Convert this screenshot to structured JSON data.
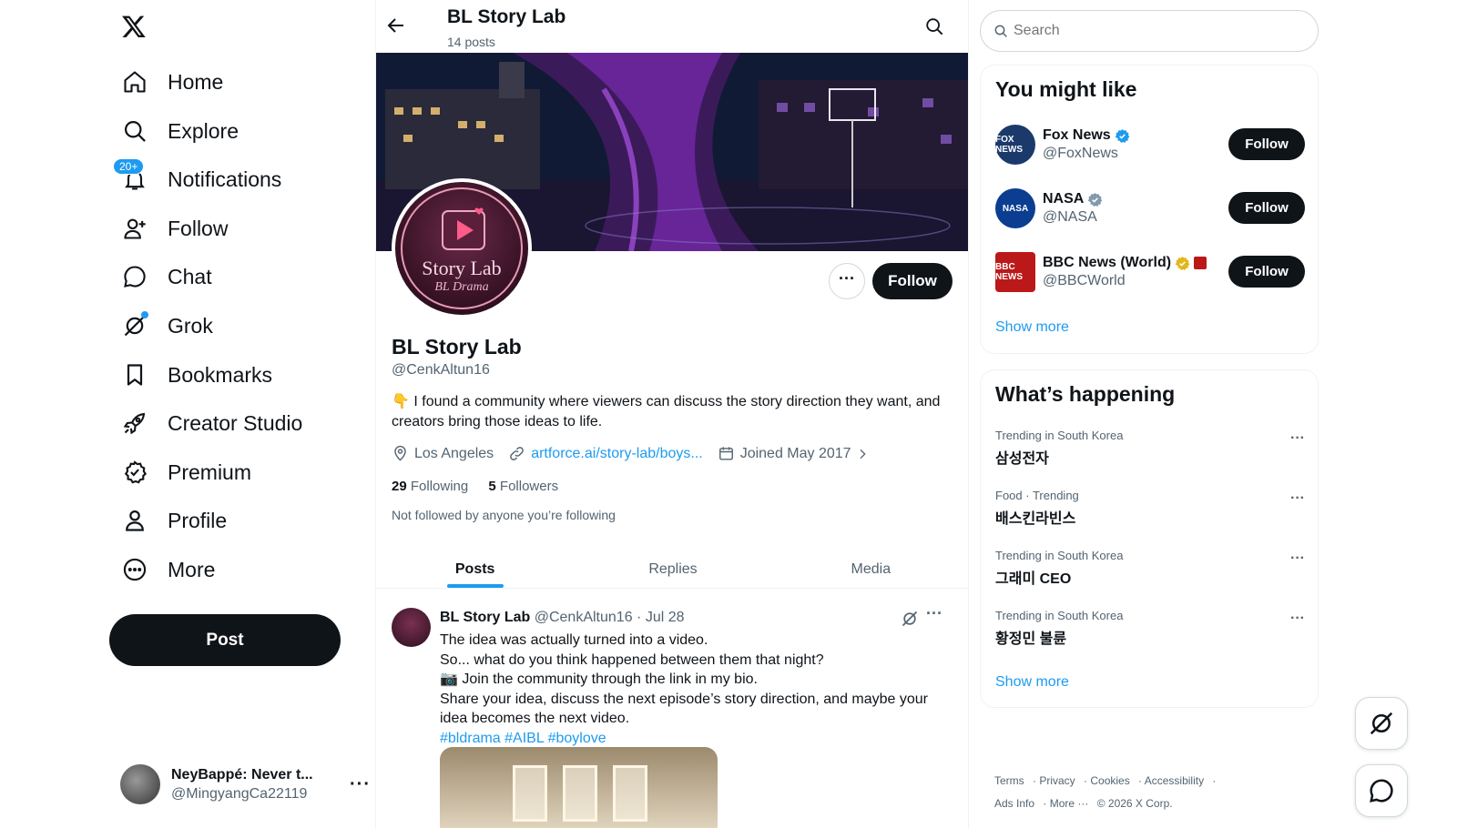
{
  "nav": {
    "items": [
      {
        "label": "Home",
        "icon": "home-icon"
      },
      {
        "label": "Explore",
        "icon": "search-icon"
      },
      {
        "label": "Notifications",
        "icon": "bell-icon",
        "badge": "20+"
      },
      {
        "label": "Follow",
        "icon": "follow-icon"
      },
      {
        "label": "Chat",
        "icon": "chat-icon"
      },
      {
        "label": "Grok",
        "icon": "grok-icon"
      },
      {
        "label": "Bookmarks",
        "icon": "bookmark-icon"
      },
      {
        "label": "Creator Studio",
        "icon": "rocket-icon"
      },
      {
        "label": "Premium",
        "icon": "premium-icon"
      },
      {
        "label": "Profile",
        "icon": "profile-icon"
      },
      {
        "label": "More",
        "icon": "more-circle-icon"
      }
    ],
    "post_label": "Post"
  },
  "account": {
    "name": "NeyBappé: Never t...",
    "handle": "@MingyangCa22119"
  },
  "header": {
    "title": "BL Story Lab",
    "subtitle": "14 posts"
  },
  "profile": {
    "avatar_text": "Story Lab",
    "avatar_subtext": "BL Drama",
    "follow_label": "Follow",
    "name": "BL Story Lab",
    "handle": "@CenkAltun16",
    "bio_emoji": "👇",
    "bio": "I found a community where viewers can discuss the story direction they want, and creators bring those ideas to life.",
    "location": "Los Angeles",
    "website": "artforce.ai/story-lab/boys...",
    "joined": "Joined May 2017",
    "following_count": "29",
    "following_label": "Following",
    "followers_count": "5",
    "followers_label": "Followers",
    "not_followed": "Not followed by anyone you’re following"
  },
  "tabs": [
    "Posts",
    "Replies",
    "Media"
  ],
  "post": {
    "author": "BL Story Lab",
    "handle_date": "@CenkAltun16 · Jul 28",
    "lines": [
      "The idea was actually turned into a video.",
      "So... what do you think happened between them that night?",
      "📷 Join the community through the link in my bio.",
      "Share your idea, discuss the next episode’s story direction, and maybe your idea becomes the next video."
    ],
    "hashtags": "#bldrama #AIBL #boylove"
  },
  "search": {
    "placeholder": "Search"
  },
  "suggestions": {
    "title": "You might like",
    "items": [
      {
        "name": "Fox News",
        "handle": "@FoxNews",
        "follow": "Follow",
        "avatar_text": "FOX NEWS",
        "avatar_color": "#1b3a6b",
        "verified_color": "#1d9bf0"
      },
      {
        "name": "NASA",
        "handle": "@NASA",
        "follow": "Follow",
        "avatar_text": "NASA",
        "avatar_color": "#0b3d91",
        "verified_color": "#829aab"
      },
      {
        "name": "BBC News (World)",
        "handle": "@BBCWorld",
        "follow": "Follow",
        "avatar_text": "BBC NEWS",
        "avatar_color": "#bb1919",
        "verified_color": "#e2b719"
      }
    ],
    "show_more": "Show more"
  },
  "trends": {
    "title": "What’s happening",
    "items": [
      {
        "context": "Trending in South Korea",
        "topic": "삼성전자"
      },
      {
        "context": "Food · Trending",
        "topic": "배스킨라빈스"
      },
      {
        "context": "Trending in South Korea",
        "topic": "그래미 CEO"
      },
      {
        "context": "Trending in South Korea",
        "topic": "황정민 불륜"
      }
    ],
    "show_more": "Show more"
  },
  "footer": {
    "links": [
      "Terms",
      "Privacy",
      "Cookies",
      "Accessibility",
      "Ads Info",
      "More ···",
      "© 2026 X Corp."
    ]
  }
}
